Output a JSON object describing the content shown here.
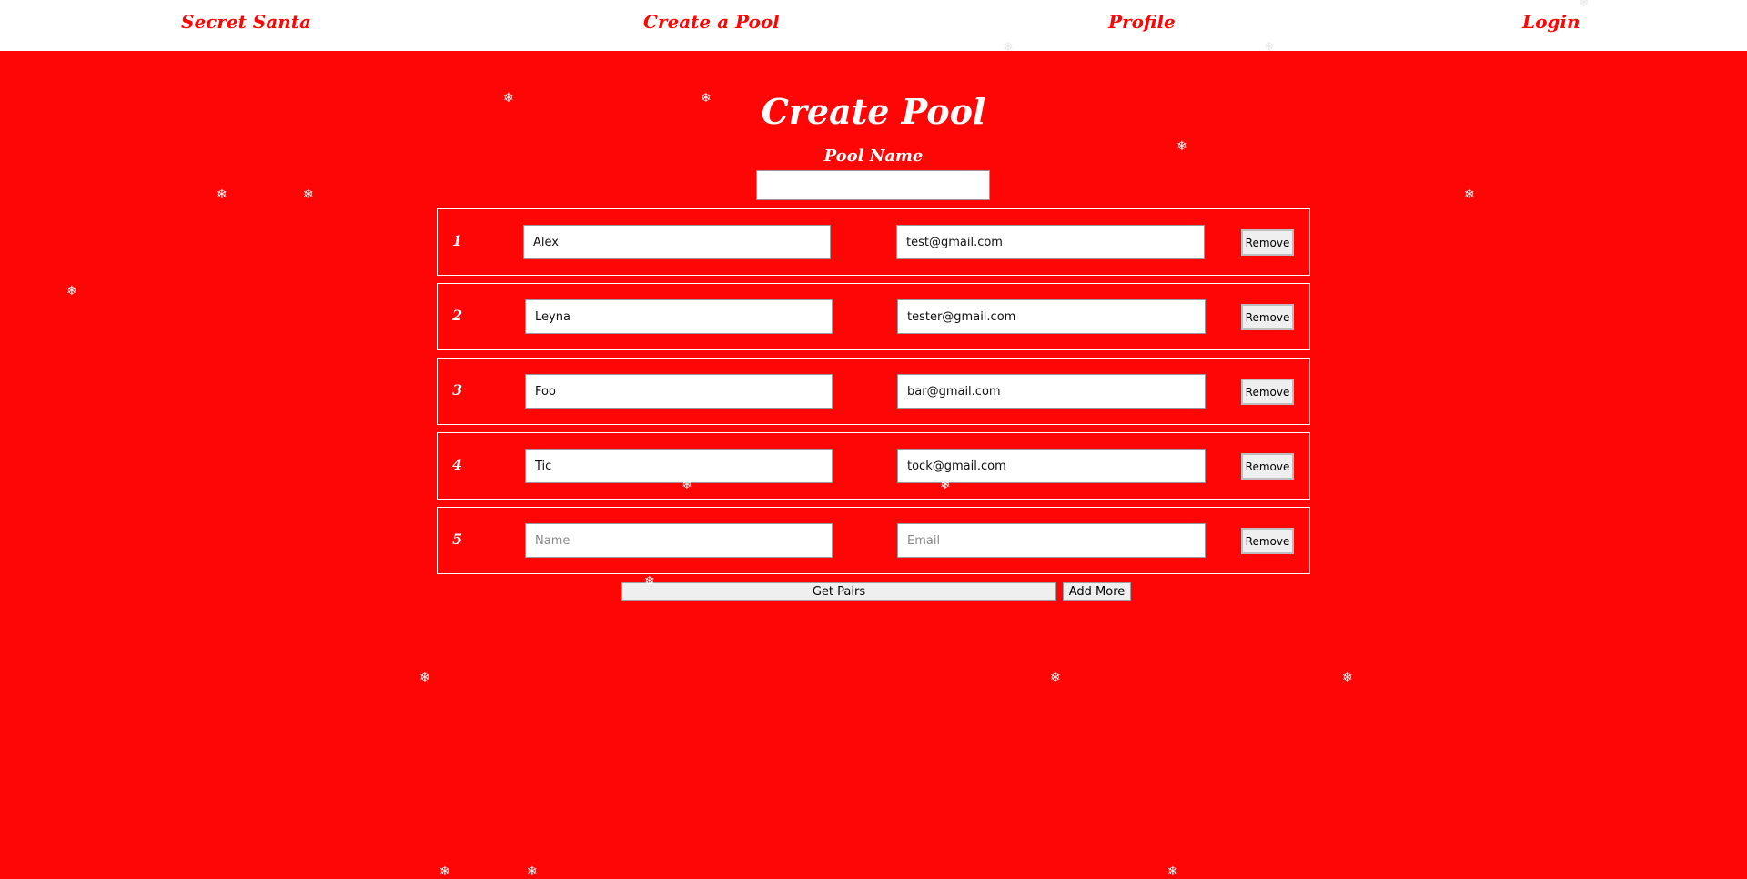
{
  "nav": {
    "brand": "Secret Santa",
    "create_pool": "Create a Pool",
    "profile": "Profile",
    "login": "Login"
  },
  "page": {
    "title": "Create Pool",
    "pool_name_label": "Pool Name",
    "pool_name_value": ""
  },
  "participants": [
    {
      "number": "1",
      "name": "Alex",
      "email": "test@gmail.com",
      "remove_label": "Remove"
    },
    {
      "number": "2",
      "name": "Leyna",
      "email": "tester@gmail.com",
      "remove_label": "Remove"
    },
    {
      "number": "3",
      "name": "Foo",
      "email": "bar@gmail.com",
      "remove_label": "Remove"
    },
    {
      "number": "4",
      "name": "Tic",
      "email": "tock@gmail.com",
      "remove_label": "Remove"
    },
    {
      "number": "5",
      "name": "",
      "email": "",
      "remove_label": "Remove",
      "name_placeholder": "Name",
      "email_placeholder": "Email"
    }
  ],
  "actions": {
    "get_pairs_label": "Get Pairs",
    "add_more_label": "Add More"
  },
  "decoration": {
    "snowflake_glyph": "❄",
    "background_color": "#ff0606",
    "accent_color": "#ffffff"
  }
}
